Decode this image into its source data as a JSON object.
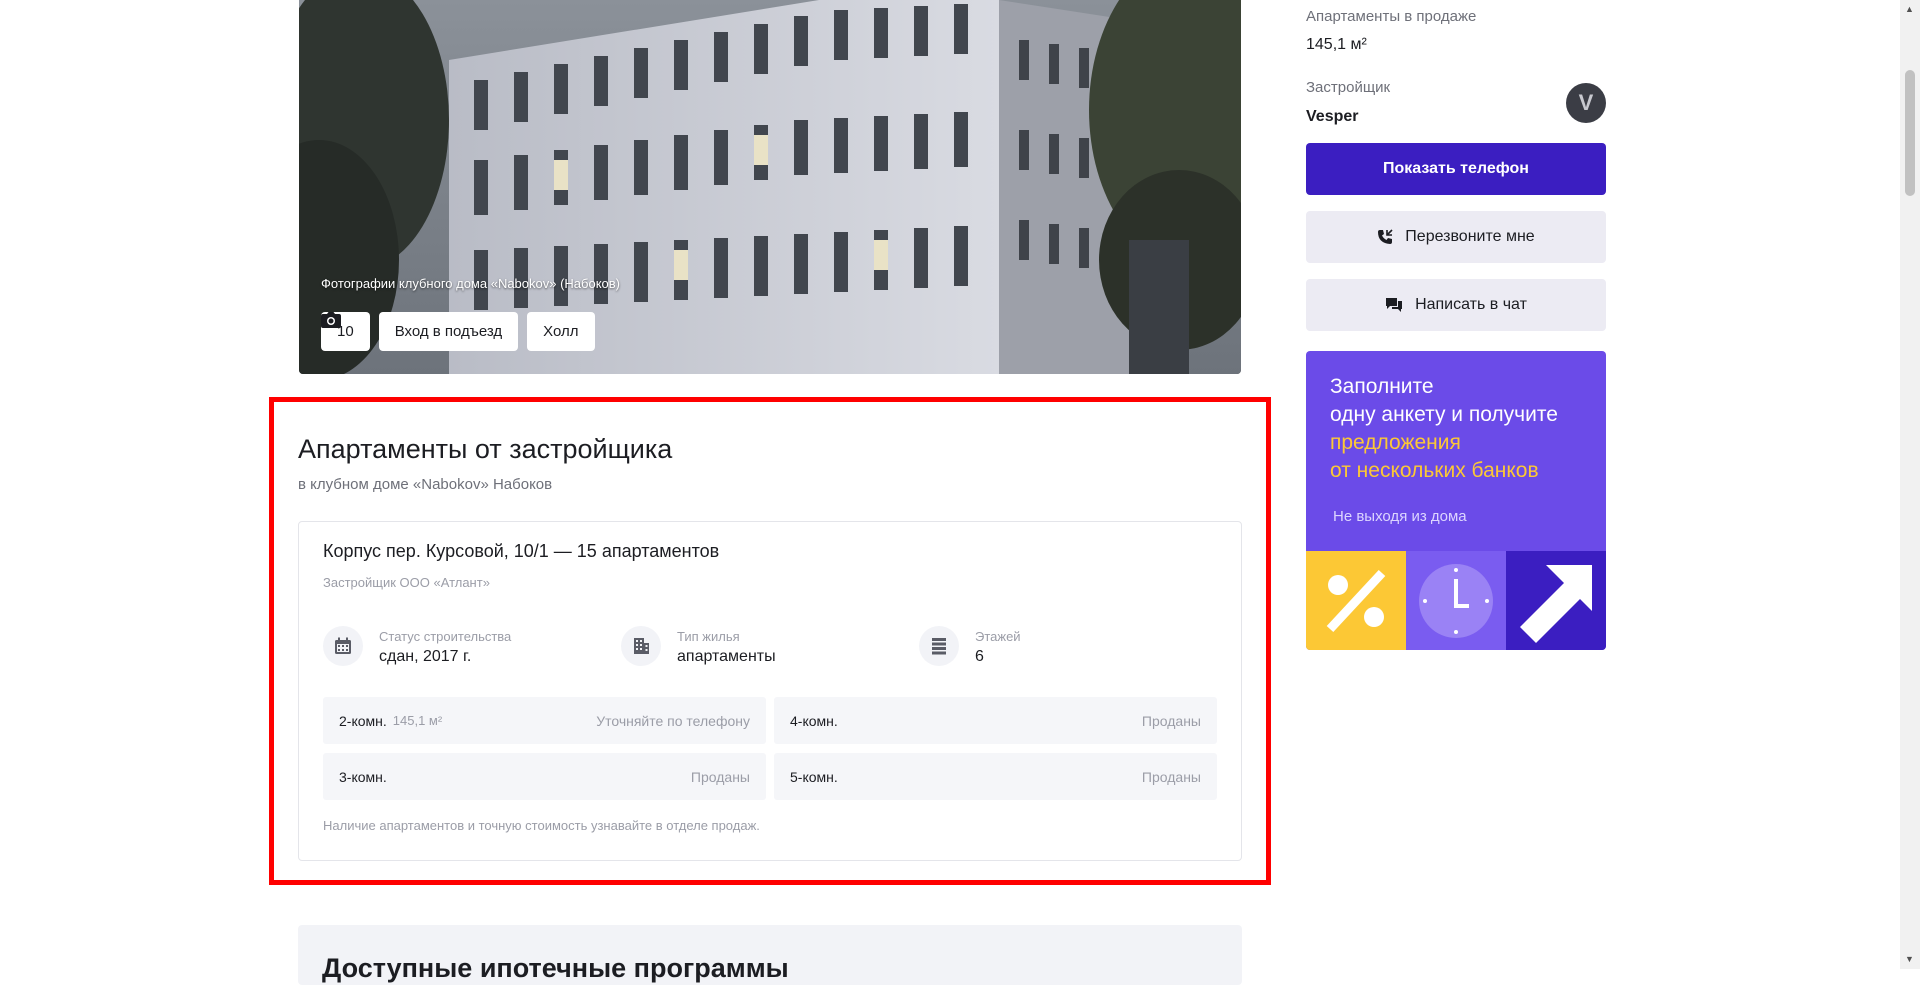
{
  "photo": {
    "caption": "Фотографии клубного дома «Nabokov» (Набоков)",
    "photo_count": "10",
    "chips": [
      "Вход в подъезд",
      "Холл"
    ]
  },
  "section": {
    "title": "Апартаменты от застройщика",
    "subtitle": "в клубном доме «Nabokov» Набоков"
  },
  "building": {
    "title": "Корпус пер. Курсовой, 10/1 — 15 апартаментов",
    "developer": "Застройщик ООО «Атлант»",
    "facts": [
      {
        "label": "Статус строительства",
        "value": "сдан, 2017 г.",
        "icon": "calendar-icon"
      },
      {
        "label": "Тип жилья",
        "value": "апартаменты",
        "icon": "building-icon"
      },
      {
        "label": "Этажей",
        "value": "6",
        "icon": "floors-icon"
      }
    ],
    "rooms": [
      {
        "name": "2-комн.",
        "area": "145,1 м²",
        "status": "Уточняйте по телефону"
      },
      {
        "name": "4-комн.",
        "area": "",
        "status": "Проданы"
      },
      {
        "name": "3-комн.",
        "area": "",
        "status": "Проданы"
      },
      {
        "name": "5-комн.",
        "area": "",
        "status": "Проданы"
      }
    ],
    "note": "Наличие апартаментов и точную стоимость узнавайте в отделе продаж."
  },
  "next_section": {
    "title": "Доступные ипотечные программы"
  },
  "sidebar": {
    "sale_label": "Апартаменты в продаже",
    "sale_value": "145,1 м²",
    "developer_label": "Застройщик",
    "developer_value": "Vesper",
    "developer_logo_letter": "V",
    "show_phone": "Показать телефон",
    "callback": "Перезвоните мне",
    "chat": "Написать в чат",
    "promo": {
      "line1": "Заполните",
      "line2": "одну анкету и получите",
      "line3": "предложения",
      "line4": "от нескольких банков",
      "sub": "Не выходя из дома"
    }
  },
  "colors": {
    "primary": "#3b1ec1",
    "promo_bg": "#6b4be8",
    "promo_accent": "#fcc835",
    "highlight_frame": "#ff0000"
  }
}
